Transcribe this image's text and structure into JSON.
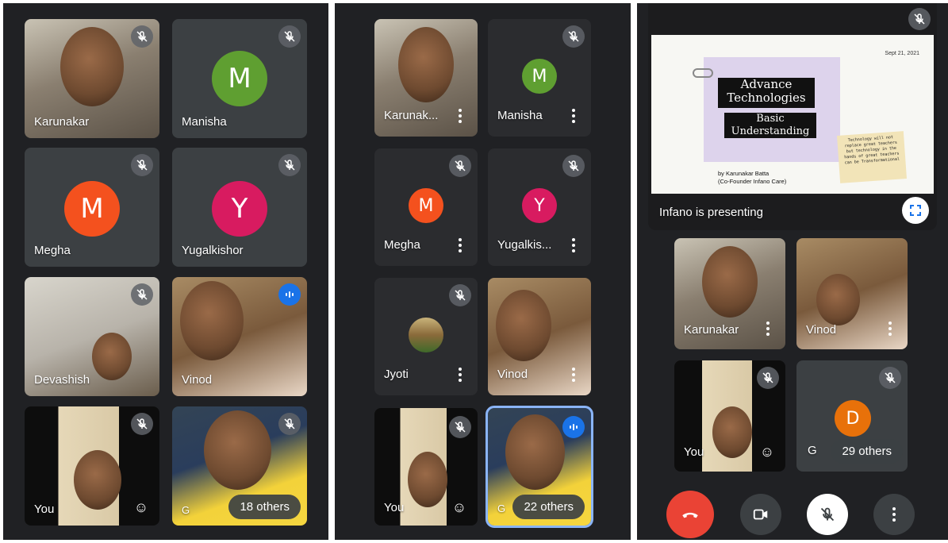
{
  "panel1": {
    "tiles": [
      {
        "name": "Karunakar"
      },
      {
        "name": "Manisha",
        "initial": "M",
        "color": "#5f9f31"
      },
      {
        "name": "Megha",
        "initial": "M",
        "color": "#f4511e"
      },
      {
        "name": "Yugalkishor",
        "initial": "Y",
        "color": "#d81b60"
      },
      {
        "name": "Devashish"
      },
      {
        "name": "Vinod"
      },
      {
        "name": "You"
      },
      {
        "name": "G"
      }
    ],
    "others_label": "18 others"
  },
  "panel2": {
    "tiles": [
      {
        "name": "Karunak..."
      },
      {
        "name": "Manisha",
        "initial": "M",
        "color": "#5f9f31"
      },
      {
        "name": "Megha",
        "initial": "M",
        "color": "#f4511e"
      },
      {
        "name": "Yugalkis...",
        "initial": "Y",
        "color": "#d81b60"
      },
      {
        "name": "Jyoti"
      },
      {
        "name": "Vinod"
      },
      {
        "name": "You"
      },
      {
        "name": "G"
      }
    ],
    "others_label": "22 others"
  },
  "panel3": {
    "slide": {
      "date": "Sept 21, 2021",
      "title_line1": "Advance",
      "title_line2": "Technologies",
      "subtitle_line1": "Basic",
      "subtitle_line2": "Understanding",
      "quote": "Technology will not replace great teachers but technology in the hands of great teachers can be Transformational",
      "author_line1": "by Karunakar Batta",
      "author_line2": "(Co-Founder Infano Care)"
    },
    "presenting_label": "Infano is presenting",
    "tiles": [
      {
        "name": "Karunakar"
      },
      {
        "name": "Vinod"
      },
      {
        "name": "You"
      },
      {
        "name": "G",
        "initial": "D",
        "color": "#e8710a"
      }
    ],
    "others_label": "29 others"
  },
  "colors": {
    "background": "#202124",
    "tile": "#3c4043",
    "end_call": "#ea4335",
    "speaking": "#1a73e8"
  }
}
